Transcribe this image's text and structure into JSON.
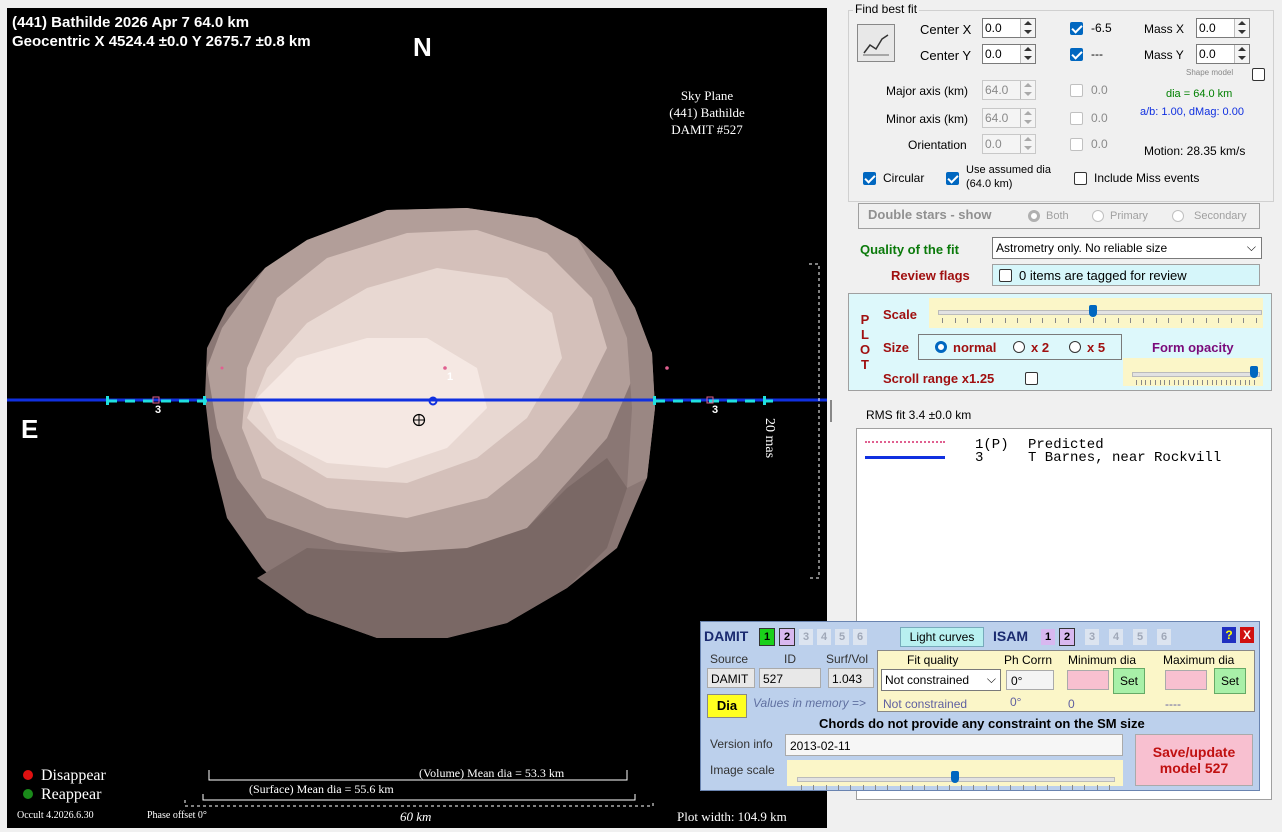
{
  "plot": {
    "title_line1": "(441) Bathilde  2026 Apr 7   64.0 km",
    "title_line2": "Geocentric X 4524.4 ±0.0  Y 2675.7 ±0.8 km",
    "north": "N",
    "east": "E",
    "sky_plane": [
      "Sky Plane",
      "(441) Bathilde",
      "DAMIT #527"
    ],
    "chord_label_left": "3",
    "chord_label_right": "3",
    "predicted_label": "1",
    "scale_label": "20 mas",
    "legend_disappear": "Disappear",
    "legend_reappear": "Reappear",
    "volume_mean": "(Volume) Mean dia = 53.3 km",
    "surface_mean": "(Surface) Mean dia = 55.6 km",
    "width_60": "60 km",
    "version": "Occult 4.2026.6.30",
    "phase_offset": "Phase offset 0°",
    "plot_width": "Plot width: 104.9 km",
    "colors": {
      "disappear": "#e01010",
      "reappear": "#1a8a1a",
      "chord": "#1030e0",
      "chord_dash": "#20e0e0"
    }
  },
  "fit": {
    "group_title": "Find best fit",
    "center_x_label": "Center X",
    "center_x": "0.0",
    "center_y_label": "Center Y",
    "center_y": "0.0",
    "cx_check_label": "-6.5",
    "cy_check_label": "---",
    "mass_x_label": "Mass X",
    "mass_x": "0.0",
    "mass_y_label": "Mass Y",
    "mass_y": "0.0",
    "shape_model_label": "Shape model",
    "major_label": "Major axis (km)",
    "major": "64.0",
    "major_chk": "0.0",
    "minor_label": "Minor axis (km)",
    "minor": "64.0",
    "minor_chk": "0.0",
    "orient_label": "Orientation",
    "orient": "0.0",
    "orient_chk": "0.0",
    "dia_info": "dia = 64.0 km",
    "ab_info": "a/b: 1.00, dMag: 0.00",
    "motion": "Motion: 28.35 km/s",
    "circular": "Circular",
    "use_assumed": "Use assumed dia (64.0 km)",
    "include_miss": "Include Miss events",
    "double_stars": "Double stars - show",
    "both": "Both",
    "primary": "Primary",
    "secondary": "Secondary",
    "quality_label": "Quality of the fit",
    "quality_value": "Astrometry only. No reliable size",
    "review_label": "Review flags",
    "review_value": "0 items are tagged for review"
  },
  "plotctl": {
    "side": [
      "P",
      "L",
      "O",
      "T"
    ],
    "scale": "Scale",
    "size": "Size",
    "normal": "normal",
    "x2": "x 2",
    "x5": "x 5",
    "form_opacity": "Form opacity",
    "scroll_range": "Scroll range x1.25",
    "scale_slider": 0.48,
    "opacity_slider": 1.0
  },
  "rms": "RMS fit 3.4 ±0.0 km",
  "observers": [
    {
      "num": "1(P)",
      "name": "Predicted"
    },
    {
      "num": "3",
      "name": "T Barnes, near Rockvill"
    }
  ],
  "damit": {
    "title": "DAMIT",
    "nums": [
      "1",
      "2",
      "3",
      "4",
      "5",
      "6"
    ],
    "light_curves": "Light curves",
    "isam": "ISAM",
    "isam_nums": [
      "1",
      "2",
      "3",
      "4",
      "5",
      "6"
    ],
    "help": "?",
    "close": "X",
    "source_h": "Source",
    "id_h": "ID",
    "surf_h": "Surf/Vol",
    "source": "DAMIT",
    "id": "527",
    "surf": "1.043",
    "fitq_h": "Fit quality",
    "phcorr_h": "Ph Corrn",
    "min_h": "Minimum dia",
    "max_h": "Maximum dia",
    "fitq": "Not constrained",
    "phcorr": "0°",
    "set": "Set",
    "dia": "Dia",
    "values_mem": "Values in memory =>",
    "mem_fitq": "Not constrained",
    "mem_ph": "0°",
    "mem_min": "0",
    "mem_max": "----",
    "chords_msg": "Chords do not provide any constraint on the SM size",
    "version_label": "Version info",
    "version": "2013-02-11",
    "image_scale": "Image scale",
    "image_scale_slider": 0.5,
    "save": "Save/update model 527"
  }
}
